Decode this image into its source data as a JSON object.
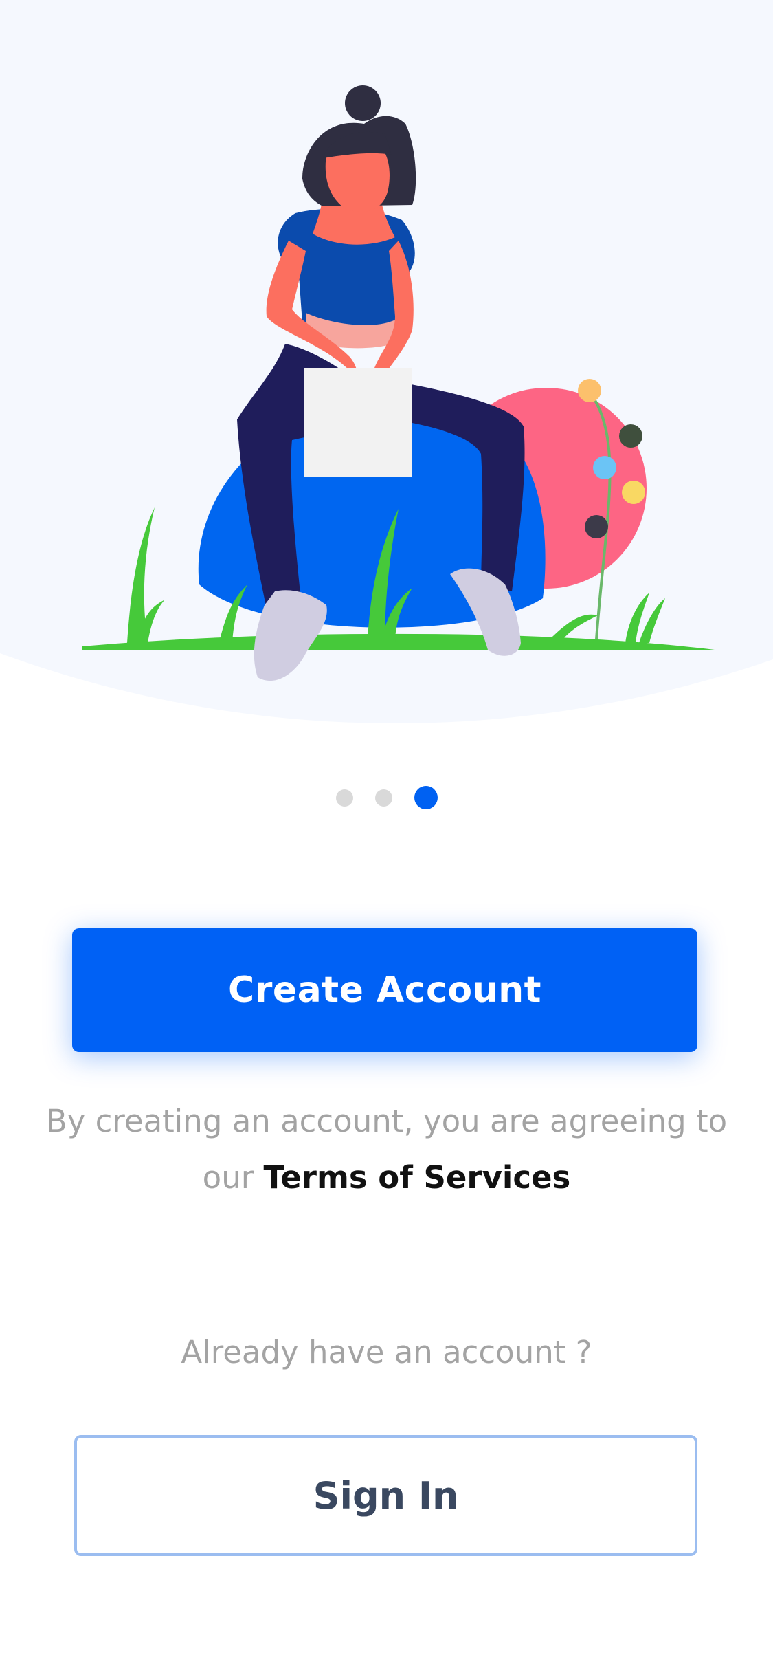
{
  "colors": {
    "primary": "#0061f5",
    "hero_background": "#f5f8fe",
    "muted_text": "#a3a3a3",
    "outline_border": "#9bbdf0",
    "dot_inactive": "#d9d9d9"
  },
  "pager": {
    "total": 3,
    "active_index": 3
  },
  "primary_action": {
    "label": "Create Account"
  },
  "terms": {
    "prefix": "By creating an account, you are agreeing to our",
    "link_label": "Terms of Services"
  },
  "signin_prompt": "Already have an account ?",
  "secondary_action": {
    "label": "Sign In"
  }
}
